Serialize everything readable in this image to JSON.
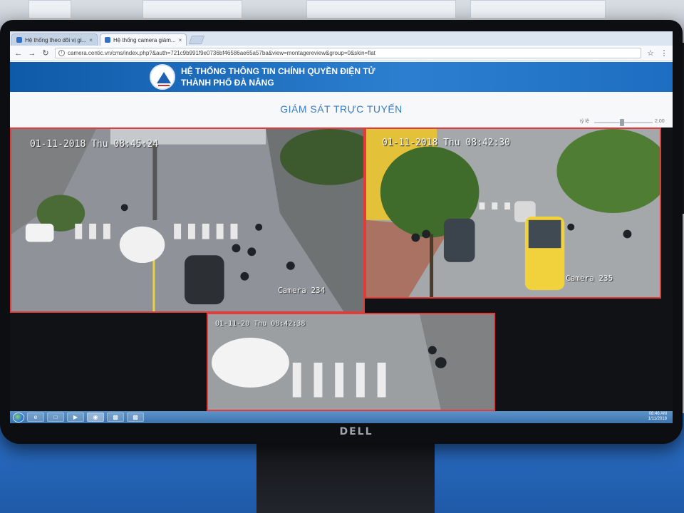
{
  "browser": {
    "tabs": [
      {
        "label": "Hệ thống theo dõi vị gi..."
      },
      {
        "label": "Hệ thống camera giám..."
      }
    ],
    "close_glyph": "×",
    "url": "camera.centic.vn/cms/index.php?&auth=721c9b991f9e0736bf46586ae65a57ba&view=montagereview&group=0&skin=flat"
  },
  "site": {
    "title_line1": "HỆ THỐNG THÔNG TIN CHÍNH QUYỀN ĐIỆN TỬ",
    "title_line2": "THÀNH PHỐ ĐÀ NẴNG",
    "logo_icon": "city-logo-icon"
  },
  "page": {
    "title": "GIÁM SÁT TRỰC TUYẾN",
    "zoom_label": "tỷ lệ",
    "zoom_value": "2.00"
  },
  "cameras": [
    {
      "timestamp": "01-11-2018 Thu 08:45:24",
      "name": "Camera 234"
    },
    {
      "timestamp": "01-11-2018 Thu 08:42:30",
      "name": "Camera 235"
    },
    {
      "timestamp": "01-11-20 Thu 08:42:38",
      "name": ""
    }
  ],
  "taskbar": {
    "tray_time": "08:46 AM",
    "tray_date": "1/11/2018"
  },
  "monitor": {
    "brand": "DELL"
  },
  "colors": {
    "banner": "#1d6ec2",
    "camera_border": "#e23b3b",
    "page_title": "#3a7cc1",
    "taskbar": "#3d74ad"
  }
}
